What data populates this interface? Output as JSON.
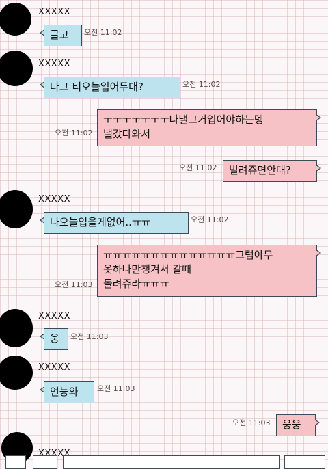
{
  "messages": [
    {
      "sender": "XXXXX",
      "text": "글고",
      "time": "오전 11:02"
    },
    {
      "sender": "XXXXX",
      "text": "나그 티오늘입어두대?",
      "time": "오전 11:02"
    },
    {
      "text": "ㅜㅜㅜㅜㅜㅜㅜ나낼그거입어야하는뎅\n낼갔다와서",
      "time": "오전 11:02"
    },
    {
      "text": "빌려쥬면안대?",
      "time": "오전 11:02"
    },
    {
      "sender": "XXXXX",
      "text": "나오늘입을게없어..ㅠㅠ",
      "time": "오전 11:02"
    },
    {
      "text": "ㅠㅠㅠㅠㅠㅠㅠㅠㅠㅠㅠㅠㅠㅠ그럼아무\n옷하나만챙겨서 갈때\n돌려쥬라ㅠㅠㅠ",
      "time": "오전 11:03"
    },
    {
      "sender": "XXXXX",
      "text": "웅",
      "time": "오전 11:03"
    },
    {
      "sender": "XXXXX",
      "text": "언능와",
      "time": "오전 11:03"
    },
    {
      "text": "웅웅",
      "time": "오전 11:03"
    },
    {
      "sender": "XXXXX"
    }
  ],
  "colors": {
    "incoming_bubble": "#bde3ee",
    "outgoing_bubble": "#f7c2c6",
    "background": "#fbf7f8",
    "grid": "#d6aab4"
  }
}
